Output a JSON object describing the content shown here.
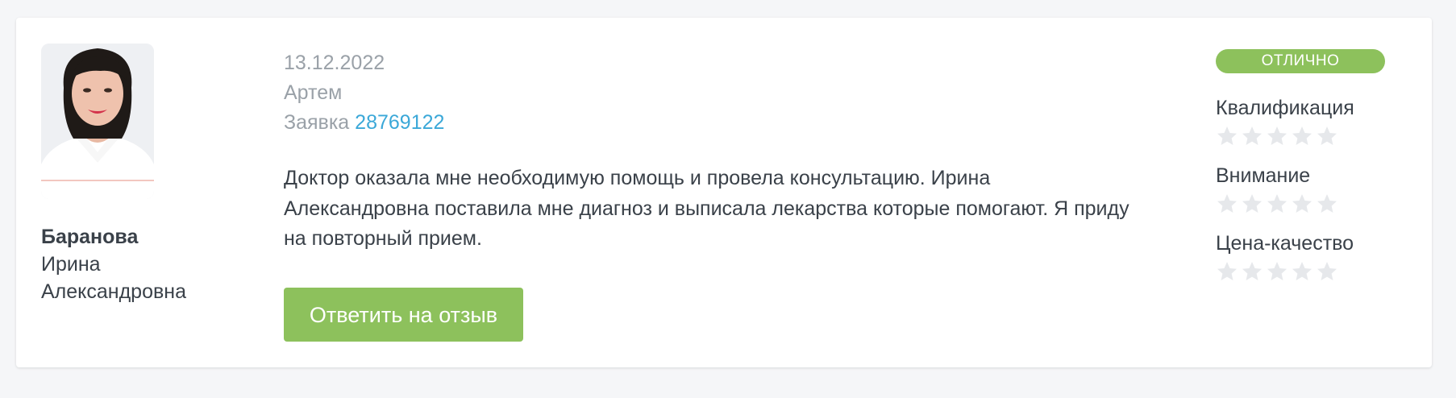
{
  "doctor": {
    "surname": "Баранова",
    "first_name": "Ирина",
    "patronymic": "Александровна"
  },
  "review": {
    "date": "13.12.2022",
    "author": "Артем",
    "application_label": "Заявка",
    "application_number": "28769122",
    "text": "Доктор оказала мне необходимую помощь и провела консультацию. Ирина Александровна поставила мне диагноз и выписала лекарства которые помогают. Я приду на повторный прием.",
    "reply_button_label": "Ответить на отзыв"
  },
  "ratings": {
    "badge": "ОТЛИЧНО",
    "items": [
      {
        "label": "Квалификация",
        "stars_filled": 0,
        "stars_total": 5
      },
      {
        "label": "Внимание",
        "stars_filled": 0,
        "stars_total": 5
      },
      {
        "label": "Цена-качество",
        "stars_filled": 0,
        "stars_total": 5
      }
    ]
  },
  "colors": {
    "accent_green": "#8dc15c",
    "link_blue": "#3ba8d8",
    "muted_text": "#9aa1a8",
    "body_text": "#3a4149",
    "empty_star": "#e6e8eb"
  },
  "icons": {
    "star": "star-icon"
  }
}
